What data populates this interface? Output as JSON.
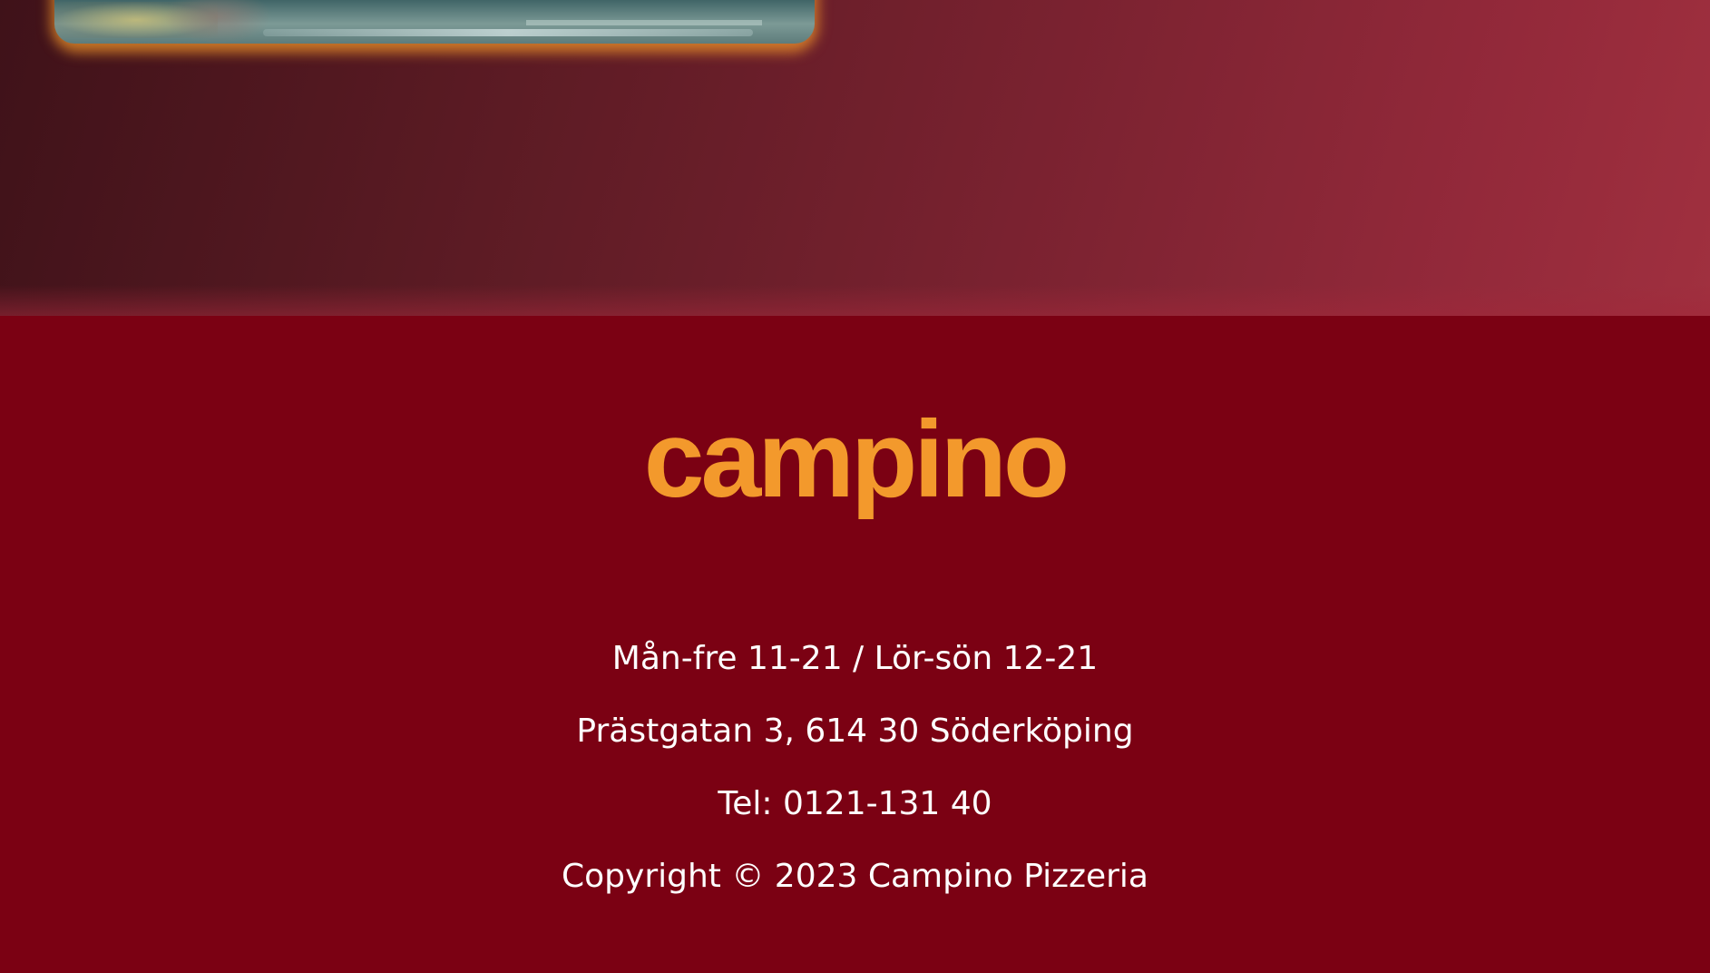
{
  "brand": {
    "logo_text": "campino"
  },
  "footer": {
    "hours": "Mån-fre 11-21 / Lör-sön 12-21",
    "address": "Prästgatan 3, 614 30 Söderköping",
    "phone": "Tel: 0121-131 40",
    "copyright": "Copyright © 2023 Campino Pizzeria"
  },
  "colors": {
    "footer_background": "#7b0113",
    "logo": "#f3992c",
    "photo_frame": "#f0962b",
    "text": "#ffffff"
  }
}
